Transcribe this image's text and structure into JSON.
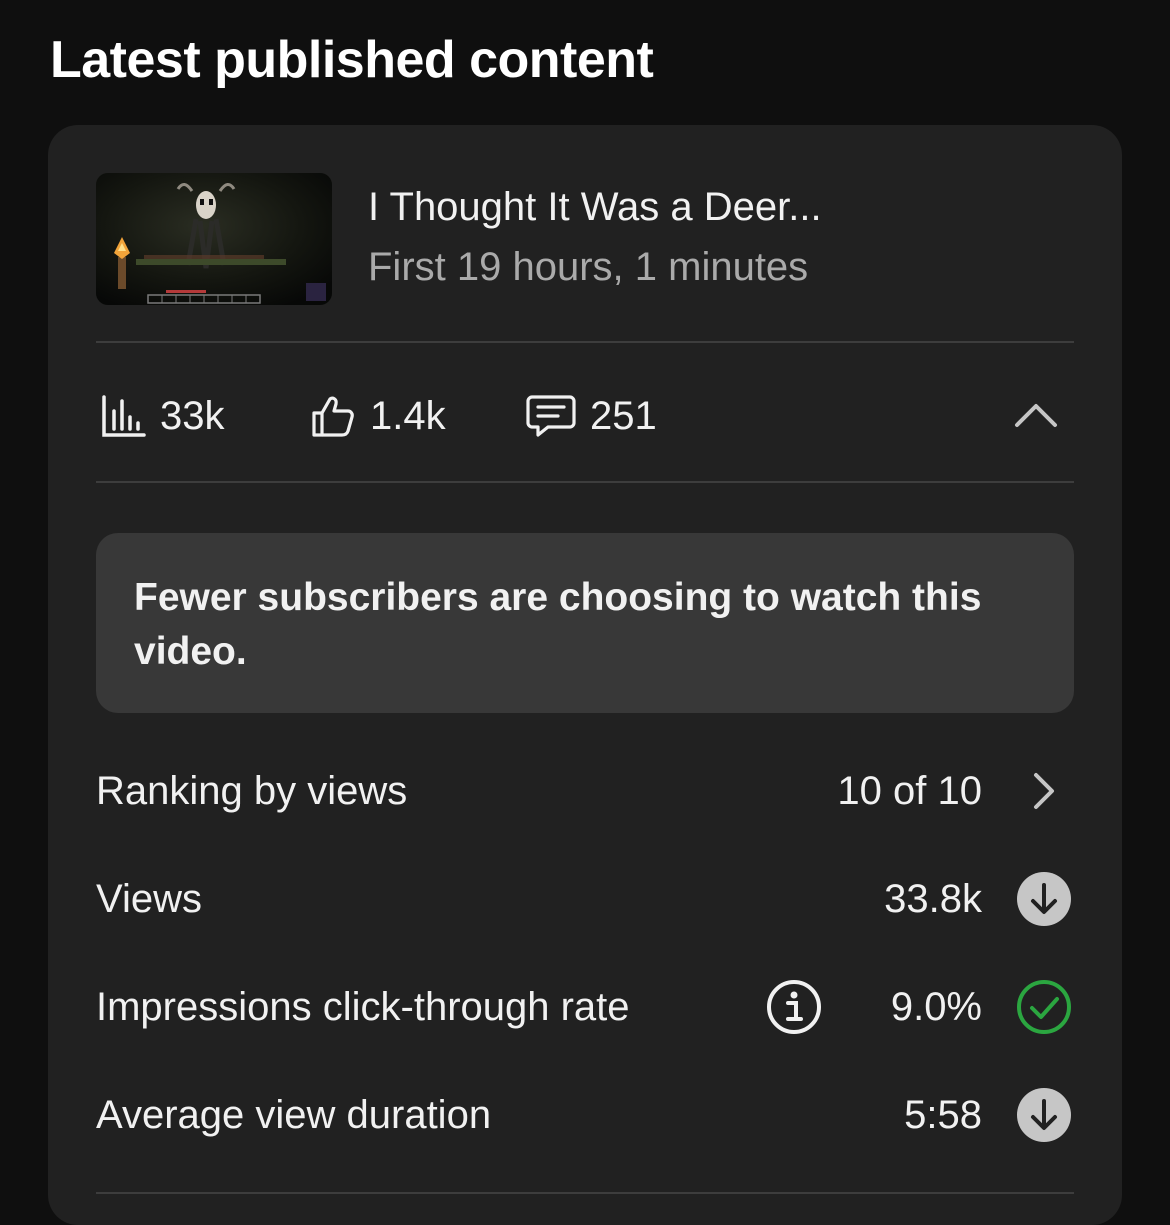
{
  "header": {
    "title": "Latest published content"
  },
  "video": {
    "title": "I Thought It Was a Deer...",
    "subtitle": "First 19 hours, 1 minutes",
    "thumbnail_icon": "minecraft-dark-forest-thumbnail"
  },
  "stats": {
    "views": {
      "icon": "bar-chart-icon",
      "value": "33k"
    },
    "likes": {
      "icon": "thumbs-up-icon",
      "value": "1.4k"
    },
    "comments": {
      "icon": "comment-icon",
      "value": "251"
    },
    "collapse_icon": "chevron-up-icon"
  },
  "insight": {
    "text": "Fewer subscribers are choosing to watch this video."
  },
  "metrics": [
    {
      "label": "Ranking by views",
      "value": "10 of 10",
      "icon": "chevron-right-icon"
    },
    {
      "label": "Views",
      "value": "33.8k",
      "icon": "arrow-down-circle-icon"
    },
    {
      "label": "Impressions click-through rate",
      "value": "9.0%",
      "icon": "check-circle-icon",
      "info_icon": "info-icon"
    },
    {
      "label": "Average view duration",
      "value": "5:58",
      "icon": "arrow-down-circle-icon"
    }
  ],
  "colors": {
    "background": "#0f0f0f",
    "card": "#212121",
    "insight_box": "#383838",
    "secondary_text": "#aaaaaa",
    "check_green": "#2ba640",
    "neutral_icon": "#c6c6c6"
  }
}
